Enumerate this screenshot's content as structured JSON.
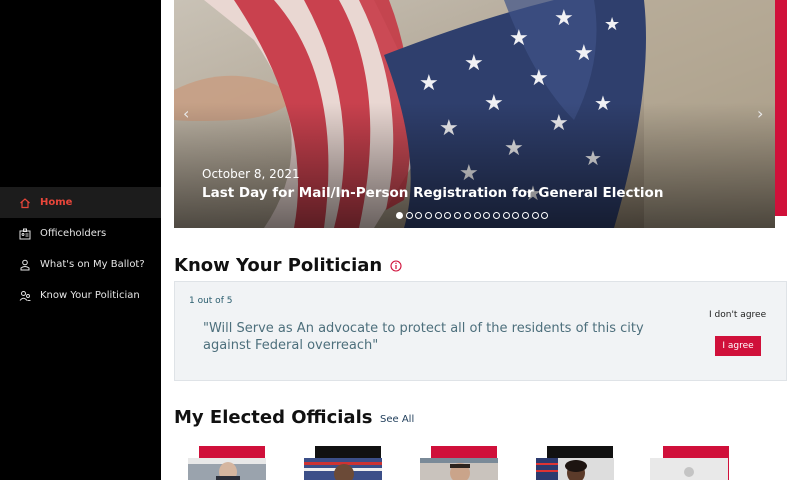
{
  "sidebar": {
    "items": [
      {
        "label": "Home",
        "icon": "home-icon",
        "active": true
      },
      {
        "label": "Officeholders",
        "icon": "id-card-icon",
        "active": false
      },
      {
        "label": "What's on My Ballot?",
        "icon": "ballot-icon",
        "active": false
      },
      {
        "label": "Know Your Politician",
        "icon": "people-icon",
        "active": false
      }
    ]
  },
  "hero": {
    "date": "October 8, 2021",
    "title": "Last Day for Mail/In-Person Registration for General Election",
    "slide_count": 16,
    "active_slide": 1,
    "prev_icon": "chevron-left-icon",
    "next_icon": "chevron-right-icon"
  },
  "know_your_politician": {
    "title": "Know Your Politician",
    "counter": "1 out of 5",
    "quote": "\"Will Serve as An advocate to protect all of the residents of this city against Federal overreach\"",
    "disagree_label": "I don't agree",
    "agree_label": "I agree"
  },
  "elected_officials": {
    "title": "My Elected Officials",
    "see_all_label": "See All"
  },
  "colors": {
    "accent": "#d0103a",
    "active_nav": "#e8463a",
    "sidebar_bg": "#000000"
  }
}
